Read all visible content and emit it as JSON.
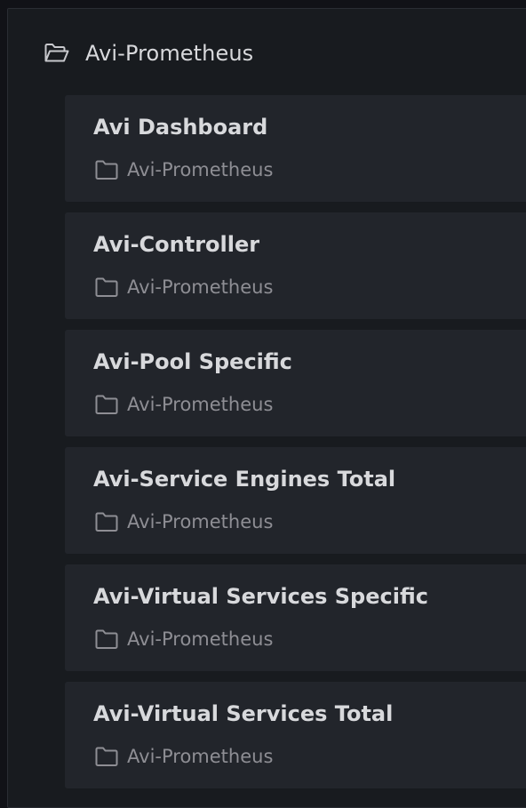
{
  "folder": {
    "title": "Avi-Prometheus",
    "icon": "folder-open-icon"
  },
  "dashboards": [
    {
      "title": "Avi Dashboard",
      "folder": "Avi-Prometheus"
    },
    {
      "title": "Avi-Controller",
      "folder": "Avi-Prometheus"
    },
    {
      "title": "Avi-Pool Specific",
      "folder": "Avi-Prometheus"
    },
    {
      "title": "Avi-Service Engines Total",
      "folder": "Avi-Prometheus"
    },
    {
      "title": "Avi-Virtual Services Specific",
      "folder": "Avi-Prometheus"
    },
    {
      "title": "Avi-Virtual Services Total",
      "folder": "Avi-Prometheus"
    }
  ],
  "colors": {
    "background": "#111217",
    "panel": "#181b1f",
    "card": "#22252b",
    "text_primary": "#d8d9dc",
    "text_secondary": "#8e8e94"
  }
}
